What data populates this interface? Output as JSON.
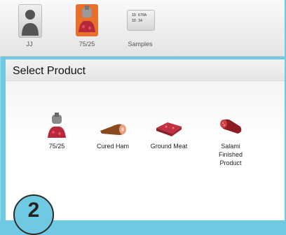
{
  "toolbar": {
    "items": [
      {
        "label": "JJ",
        "icon": "user-icon"
      },
      {
        "label": "75/25",
        "icon": "meat-grinder-icon"
      },
      {
        "label": "Samples",
        "icon": "sample-labels-icon",
        "icon_text": [
          "ID 670A",
          "ID 34"
        ]
      }
    ]
  },
  "panel": {
    "title": "Select Product",
    "products": [
      {
        "label": "75/25",
        "icon": "meat-grinder-icon"
      },
      {
        "label": "Cured Ham",
        "icon": "ham-icon"
      },
      {
        "label": "Ground Meat",
        "icon": "ground-meat-icon"
      },
      {
        "label": "Salami\nFinished\nProduct",
        "icon": "salami-icon"
      }
    ]
  },
  "step_badge": "2",
  "colors": {
    "background": "#6fc9e2",
    "accent": "#e8702a"
  }
}
